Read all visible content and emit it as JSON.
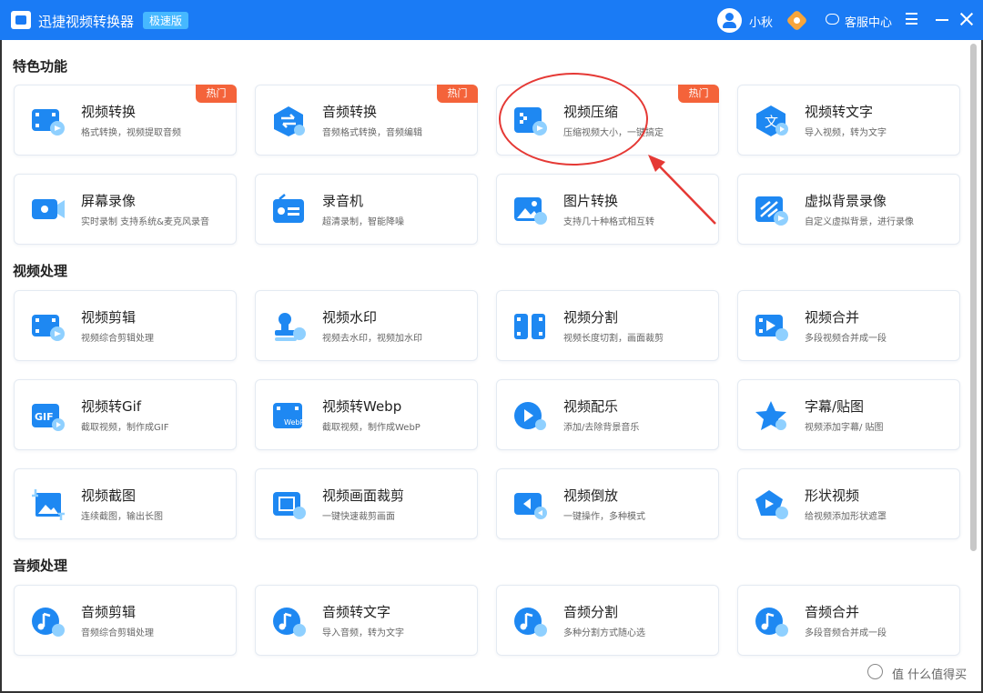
{
  "titlebar": {
    "app_title": "迅捷视频转换器",
    "edition_badge": "极速版",
    "username": "小秋",
    "service_center": "客服中心"
  },
  "sections": [
    {
      "title": "特色功能",
      "cards": [
        {
          "title": "视频转换",
          "desc": "格式转换，视频提取音频",
          "hot": "热门",
          "icon": "video-convert-icon",
          "name": "card-video-convert"
        },
        {
          "title": "音频转换",
          "desc": "音频格式转换，音频编辑",
          "hot": "热门",
          "icon": "audio-convert-icon",
          "name": "card-audio-convert"
        },
        {
          "title": "视频压缩",
          "desc": "压缩视频大小，一键搞定",
          "hot": "热门",
          "icon": "video-compress-icon",
          "name": "card-video-compress"
        },
        {
          "title": "视频转文字",
          "desc": "导入视频，转为文字",
          "hot": "",
          "icon": "video-to-text-icon",
          "name": "card-video-to-text"
        },
        {
          "title": "屏幕录像",
          "desc": "实时录制 支持系统&麦克风录音",
          "hot": "",
          "icon": "screen-record-icon",
          "name": "card-screen-record"
        },
        {
          "title": "录音机",
          "desc": "超清录制，智能降噪",
          "hot": "",
          "icon": "recorder-icon",
          "name": "card-recorder"
        },
        {
          "title": "图片转换",
          "desc": "支持几十种格式相互转",
          "hot": "",
          "icon": "image-convert-icon",
          "name": "card-image-convert"
        },
        {
          "title": "虚拟背景录像",
          "desc": "自定义虚拟背景，进行录像",
          "hot": "",
          "icon": "virtual-background-icon",
          "name": "card-virtual-background"
        }
      ]
    },
    {
      "title": "视频处理",
      "cards": [
        {
          "title": "视频剪辑",
          "desc": "视频综合剪辑处理",
          "hot": "",
          "icon": "video-edit-icon",
          "name": "card-video-edit"
        },
        {
          "title": "视频水印",
          "desc": "视频去水印，视频加水印",
          "hot": "",
          "icon": "video-watermark-icon",
          "name": "card-video-watermark"
        },
        {
          "title": "视频分割",
          "desc": "视频长度切割，画面裁剪",
          "hot": "",
          "icon": "video-split-icon",
          "name": "card-video-split"
        },
        {
          "title": "视频合并",
          "desc": "多段视频合并成一段",
          "hot": "",
          "icon": "video-merge-icon",
          "name": "card-video-merge"
        },
        {
          "title": "视频转Gif",
          "desc": "截取视频，制作成GIF",
          "hot": "",
          "icon": "gif-icon",
          "name": "card-video-to-gif"
        },
        {
          "title": "视频转Webp",
          "desc": "截取视频，制作成WebP",
          "hot": "",
          "icon": "webp-icon",
          "name": "card-video-to-webp"
        },
        {
          "title": "视频配乐",
          "desc": "添加/去除背景音乐",
          "hot": "",
          "icon": "video-music-icon",
          "name": "card-video-music"
        },
        {
          "title": "字幕/贴图",
          "desc": "视频添加字幕/ 贴图",
          "hot": "",
          "icon": "subtitle-sticker-icon",
          "name": "card-subtitle-sticker"
        },
        {
          "title": "视频截图",
          "desc": "连续截图，输出长图",
          "hot": "",
          "icon": "video-screenshot-icon",
          "name": "card-video-screenshot"
        },
        {
          "title": "视频画面裁剪",
          "desc": "一键快速裁剪画面",
          "hot": "",
          "icon": "video-crop-icon",
          "name": "card-video-crop"
        },
        {
          "title": "视频倒放",
          "desc": "一键操作，多种模式",
          "hot": "",
          "icon": "video-reverse-icon",
          "name": "card-video-reverse"
        },
        {
          "title": "形状视频",
          "desc": "给视频添加形状遮罩",
          "hot": "",
          "icon": "shape-video-icon",
          "name": "card-shape-video"
        }
      ]
    },
    {
      "title": "音频处理",
      "cards": [
        {
          "title": "音频剪辑",
          "desc": "音频综合剪辑处理",
          "hot": "",
          "icon": "audio-edit-icon",
          "name": "card-audio-edit"
        },
        {
          "title": "音频转文字",
          "desc": "导入音频，转为文字",
          "hot": "",
          "icon": "audio-to-text-icon",
          "name": "card-audio-to-text"
        },
        {
          "title": "音频分割",
          "desc": "多种分割方式随心选",
          "hot": "",
          "icon": "audio-split-icon",
          "name": "card-audio-split"
        },
        {
          "title": "音频合并",
          "desc": "多段音频合并成一段",
          "hot": "",
          "icon": "audio-merge-icon",
          "name": "card-audio-merge"
        }
      ]
    }
  ],
  "watermark": "值 什么值得买",
  "colors": {
    "titlebar": "#1a7bf5",
    "icon_primary": "#1e88f2",
    "icon_secondary": "#8fd0ff",
    "hot_badge": "#f4633a",
    "annotation_red": "#e53935"
  }
}
